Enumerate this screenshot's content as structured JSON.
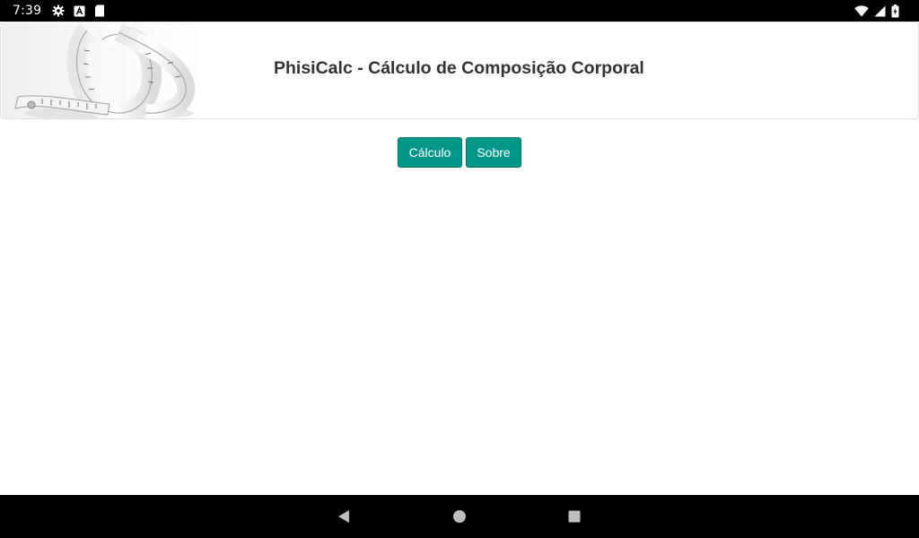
{
  "status_bar": {
    "time": "7:39",
    "left_icons": [
      "gear-icon",
      "a-box-icon",
      "sd-card-icon"
    ],
    "right_icons": [
      "wifi-icon",
      "cell-signal-icon",
      "battery-icon"
    ]
  },
  "header": {
    "title": "PhisiCalc - Cálculo de Composição Corporal",
    "image": "measuring-tape"
  },
  "actions": {
    "calc_label": "Cálculo",
    "about_label": "Sobre"
  },
  "colors": {
    "button_bg": "#009688",
    "button_border": "#00796b",
    "title_text": "#333333",
    "status_bar_bg": "#000000"
  },
  "nav_bar": {
    "buttons": [
      "back-icon",
      "home-icon",
      "recents-icon"
    ]
  }
}
